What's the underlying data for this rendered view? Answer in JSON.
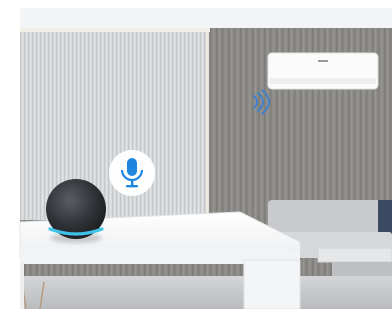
{
  "scene": {
    "kind": "photo-illustration",
    "devices": {
      "air_conditioner": {
        "icon": "air-conditioner-icon"
      },
      "smart_speaker": {
        "icon": "smart-speaker-icon",
        "ring_color": "#3fc3e8"
      },
      "voice_bubble": {
        "icon": "microphone-icon",
        "color": "#1f86e0"
      },
      "wifi_signal": {
        "icon": "wifi-signal-icon",
        "color": "#3b7fd0"
      }
    },
    "colors": {
      "ceiling": "#f3f4f6",
      "wall": "#8f8f8d",
      "panel_light": "#d9dcde",
      "table": "#f7f7f8",
      "floor": "#c7c9cb"
    }
  }
}
